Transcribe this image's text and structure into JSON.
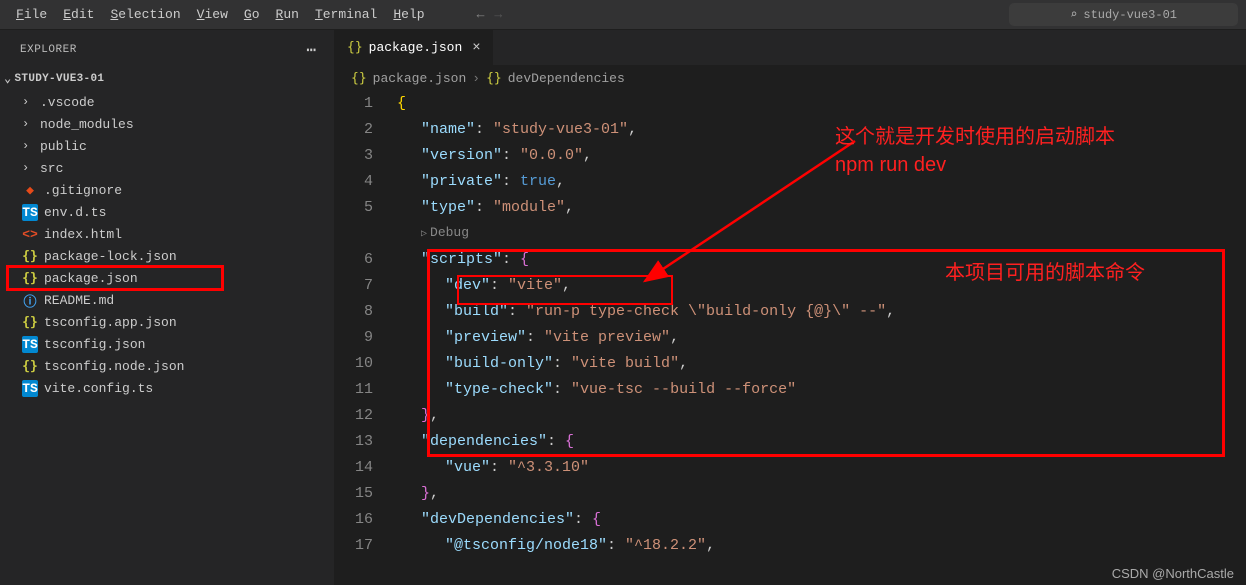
{
  "menubar": {
    "items": [
      "File",
      "Edit",
      "Selection",
      "View",
      "Go",
      "Run",
      "Terminal",
      "Help"
    ],
    "search_label": "study-vue3-01"
  },
  "sidebar": {
    "title": "EXPLORER",
    "project": "STUDY-VUE3-01",
    "tree": [
      {
        "type": "folder",
        "name": ".vscode"
      },
      {
        "type": "folder",
        "name": "node_modules"
      },
      {
        "type": "folder",
        "name": "public"
      },
      {
        "type": "folder",
        "name": "src"
      },
      {
        "type": "file",
        "name": ".gitignore",
        "icon": "git"
      },
      {
        "type": "file",
        "name": "env.d.ts",
        "icon": "ts"
      },
      {
        "type": "file",
        "name": "index.html",
        "icon": "html"
      },
      {
        "type": "file",
        "name": "package-lock.json",
        "icon": "json"
      },
      {
        "type": "file",
        "name": "package.json",
        "icon": "json",
        "selected": true
      },
      {
        "type": "file",
        "name": "README.md",
        "icon": "readme"
      },
      {
        "type": "file",
        "name": "tsconfig.app.json",
        "icon": "json"
      },
      {
        "type": "file",
        "name": "tsconfig.json",
        "icon": "tscfg"
      },
      {
        "type": "file",
        "name": "tsconfig.node.json",
        "icon": "json"
      },
      {
        "type": "file",
        "name": "vite.config.ts",
        "icon": "ts"
      }
    ]
  },
  "tabs": {
    "active": {
      "name": "package.json"
    }
  },
  "breadcrumb": {
    "parts": [
      "package.json",
      "devDependencies"
    ]
  },
  "code": {
    "debug_label": "Debug",
    "lines": [
      {
        "n": 1,
        "indent": 0,
        "tokens": [
          {
            "t": "{",
            "c": "brace"
          }
        ]
      },
      {
        "n": 2,
        "indent": 1,
        "tokens": [
          {
            "t": "\"name\"",
            "c": "key"
          },
          {
            "t": ": ",
            "c": "punc"
          },
          {
            "t": "\"study-vue3-01\"",
            "c": "str"
          },
          {
            "t": ",",
            "c": "punc"
          }
        ]
      },
      {
        "n": 3,
        "indent": 1,
        "tokens": [
          {
            "t": "\"version\"",
            "c": "key"
          },
          {
            "t": ": ",
            "c": "punc"
          },
          {
            "t": "\"0.0.0\"",
            "c": "str"
          },
          {
            "t": ",",
            "c": "punc"
          }
        ]
      },
      {
        "n": 4,
        "indent": 1,
        "tokens": [
          {
            "t": "\"private\"",
            "c": "key"
          },
          {
            "t": ": ",
            "c": "punc"
          },
          {
            "t": "true",
            "c": "bool"
          },
          {
            "t": ",",
            "c": "punc"
          }
        ]
      },
      {
        "n": 5,
        "indent": 1,
        "tokens": [
          {
            "t": "\"type\"",
            "c": "key"
          },
          {
            "t": ": ",
            "c": "punc"
          },
          {
            "t": "\"module\"",
            "c": "str"
          },
          {
            "t": ",",
            "c": "punc"
          }
        ]
      },
      {
        "n": 0,
        "debug": true
      },
      {
        "n": 6,
        "indent": 1,
        "tokens": [
          {
            "t": "\"scripts\"",
            "c": "key"
          },
          {
            "t": ": ",
            "c": "punc"
          },
          {
            "t": "{",
            "c": "brace-pink"
          }
        ]
      },
      {
        "n": 7,
        "indent": 2,
        "tokens": [
          {
            "t": "\"dev\"",
            "c": "key"
          },
          {
            "t": ": ",
            "c": "punc"
          },
          {
            "t": "\"vite\"",
            "c": "str"
          },
          {
            "t": ",",
            "c": "punc"
          }
        ]
      },
      {
        "n": 8,
        "indent": 2,
        "tokens": [
          {
            "t": "\"build\"",
            "c": "key"
          },
          {
            "t": ": ",
            "c": "punc"
          },
          {
            "t": "\"run-p type-check \\\"build-only {@}\\\" --\"",
            "c": "str"
          },
          {
            "t": ",",
            "c": "punc"
          }
        ]
      },
      {
        "n": 9,
        "indent": 2,
        "tokens": [
          {
            "t": "\"preview\"",
            "c": "key"
          },
          {
            "t": ": ",
            "c": "punc"
          },
          {
            "t": "\"vite preview\"",
            "c": "str"
          },
          {
            "t": ",",
            "c": "punc"
          }
        ]
      },
      {
        "n": 10,
        "indent": 2,
        "tokens": [
          {
            "t": "\"build-only\"",
            "c": "key"
          },
          {
            "t": ": ",
            "c": "punc"
          },
          {
            "t": "\"vite build\"",
            "c": "str"
          },
          {
            "t": ",",
            "c": "punc"
          }
        ]
      },
      {
        "n": 11,
        "indent": 2,
        "tokens": [
          {
            "t": "\"type-check\"",
            "c": "key"
          },
          {
            "t": ": ",
            "c": "punc"
          },
          {
            "t": "\"vue-tsc --build --force\"",
            "c": "str"
          }
        ]
      },
      {
        "n": 12,
        "indent": 1,
        "tokens": [
          {
            "t": "}",
            "c": "brace-pink"
          },
          {
            "t": ",",
            "c": "punc"
          }
        ]
      },
      {
        "n": 13,
        "indent": 1,
        "tokens": [
          {
            "t": "\"dependencies\"",
            "c": "key"
          },
          {
            "t": ": ",
            "c": "punc"
          },
          {
            "t": "{",
            "c": "brace-pink"
          }
        ]
      },
      {
        "n": 14,
        "indent": 2,
        "tokens": [
          {
            "t": "\"vue\"",
            "c": "key"
          },
          {
            "t": ": ",
            "c": "punc"
          },
          {
            "t": "\"^3.3.10\"",
            "c": "str"
          }
        ]
      },
      {
        "n": 15,
        "indent": 1,
        "tokens": [
          {
            "t": "}",
            "c": "brace-pink"
          },
          {
            "t": ",",
            "c": "punc"
          }
        ]
      },
      {
        "n": 16,
        "indent": 1,
        "tokens": [
          {
            "t": "\"devDependencies\"",
            "c": "key"
          },
          {
            "t": ": ",
            "c": "punc"
          },
          {
            "t": "{",
            "c": "brace-pink"
          }
        ]
      },
      {
        "n": 17,
        "indent": 2,
        "tokens": [
          {
            "t": "\"@tsconfig/node18\"",
            "c": "key"
          },
          {
            "t": ": ",
            "c": "punc"
          },
          {
            "t": "\"^18.2.2\"",
            "c": "str"
          },
          {
            "t": ",",
            "c": "punc"
          }
        ]
      }
    ]
  },
  "annotations": {
    "text1_line1": "这个就是开发时使用的启动脚本",
    "text1_line2": "npm run dev",
    "text2": "本项目可用的脚本命令"
  },
  "watermark": "CSDN @NorthCastle"
}
